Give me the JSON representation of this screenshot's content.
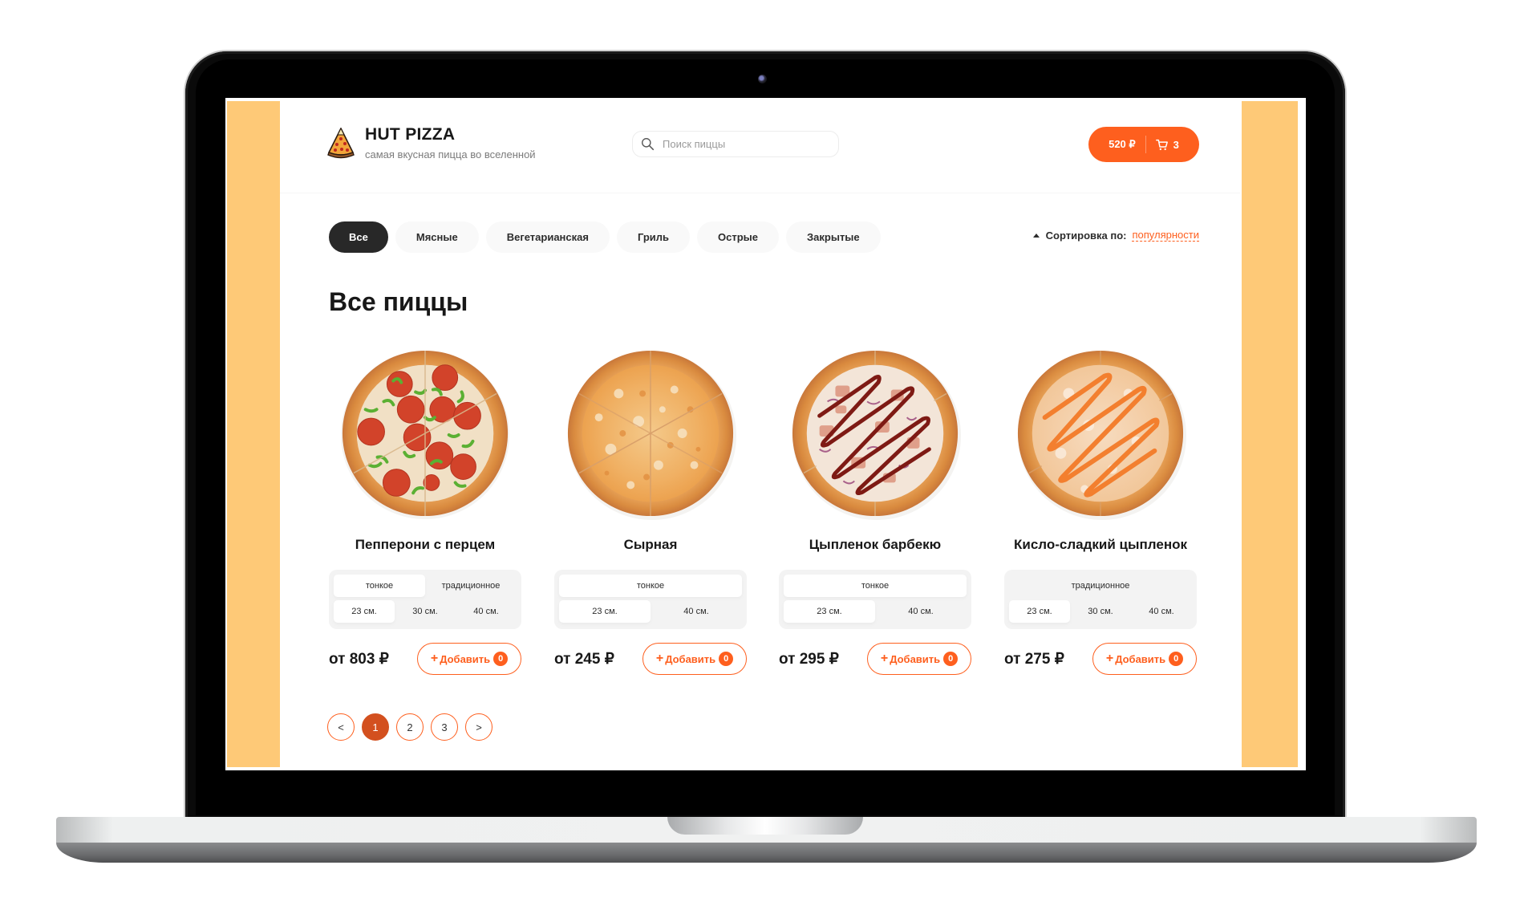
{
  "header": {
    "brand": "HUT PIZZA",
    "tagline": "самая вкусная пицца во вселенной",
    "logo_icon": "pizza-slice-icon",
    "search": {
      "placeholder": "Поиск пиццы",
      "value": "",
      "icon": "search-icon"
    },
    "cart": {
      "total": "520 ₽",
      "count": "3",
      "icon": "cart-icon"
    }
  },
  "categories": {
    "items": [
      {
        "label": "Все",
        "active": true
      },
      {
        "label": "Мясные",
        "active": false
      },
      {
        "label": "Вегетарианская",
        "active": false
      },
      {
        "label": "Гриль",
        "active": false
      },
      {
        "label": "Острые",
        "active": false
      },
      {
        "label": "Закрытые",
        "active": false
      }
    ]
  },
  "sort": {
    "label": "Сортировка по:",
    "value": "популярности",
    "direction": "up"
  },
  "page_title": "Все пиццы",
  "pizzas": [
    {
      "name": "Пепперони с перцем",
      "image": "pepperoni-pizza",
      "doughs": [
        {
          "label": "тонкое",
          "active": true
        },
        {
          "label": "традиционное",
          "active": false
        }
      ],
      "sizes": [
        {
          "label": "23 см.",
          "active": true
        },
        {
          "label": "30 см.",
          "active": false
        },
        {
          "label": "40 см.",
          "active": false
        }
      ],
      "price": "от 803 ₽",
      "add_label": "Добавить",
      "count": "0"
    },
    {
      "name": "Сырная",
      "image": "cheese-pizza",
      "doughs": [
        {
          "label": "тонкое",
          "active": true
        }
      ],
      "sizes": [
        {
          "label": "23 см.",
          "active": true
        },
        {
          "label": "40 см.",
          "active": false
        }
      ],
      "price": "от 245 ₽",
      "add_label": "Добавить",
      "count": "0"
    },
    {
      "name": "Цыпленок барбекю",
      "image": "bbq-chicken-pizza",
      "doughs": [
        {
          "label": "тонкое",
          "active": true
        }
      ],
      "sizes": [
        {
          "label": "23 см.",
          "active": true
        },
        {
          "label": "40 см.",
          "active": false
        }
      ],
      "price": "от 295 ₽",
      "add_label": "Добавить",
      "count": "0"
    },
    {
      "name": "Кисло-сладкий цыпленок",
      "image": "sweet-sour-chicken-pizza",
      "doughs": [
        {
          "label": "традиционное",
          "active": false
        }
      ],
      "sizes": [
        {
          "label": "23 см.",
          "active": true
        },
        {
          "label": "30 см.",
          "active": false
        },
        {
          "label": "40 см.",
          "active": false
        }
      ],
      "price": "от 275 ₽",
      "add_label": "Добавить",
      "count": "0"
    }
  ],
  "pagination": {
    "prev": "<",
    "pages": [
      {
        "label": "1",
        "active": true
      },
      {
        "label": "2",
        "active": false
      },
      {
        "label": "3",
        "active": false
      }
    ],
    "next": ">"
  },
  "colors": {
    "accent": "#fe5f1e",
    "page_active": "#d3501f",
    "background_band": "#fec977",
    "dark_pill": "#282828",
    "text": "#181818"
  }
}
